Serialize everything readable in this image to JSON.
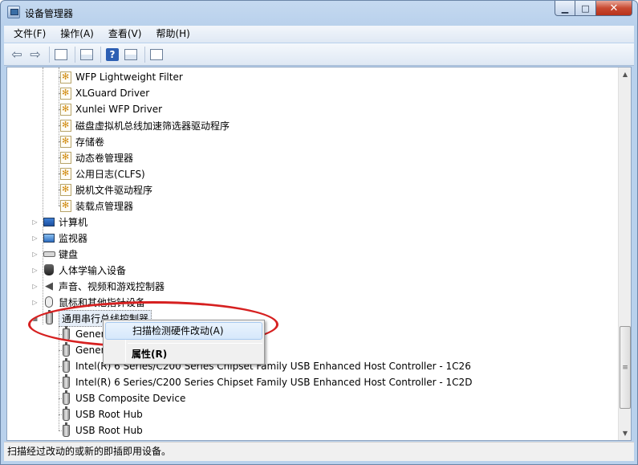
{
  "window": {
    "title": "设备管理器",
    "min_label": "▁",
    "max_label": "□",
    "close_label": "✕"
  },
  "menubar": [
    {
      "label": "文件(F)"
    },
    {
      "label": "操作(A)"
    },
    {
      "label": "查看(V)"
    },
    {
      "label": "帮助(H)"
    }
  ],
  "toolbar": {
    "back_icon": "arrow-left-icon",
    "forward_icon": "arrow-right-icon",
    "help_glyph": "?"
  },
  "tree": {
    "storage_children": [
      {
        "label": "WFP Lightweight Filter",
        "icon": "driver-icon"
      },
      {
        "label": "XLGuard Driver",
        "icon": "driver-icon"
      },
      {
        "label": "Xunlei WFP Driver",
        "icon": "driver-icon"
      },
      {
        "label": "磁盘虚拟机总线加速筛选器驱动程序",
        "icon": "driver-icon"
      },
      {
        "label": "存储卷",
        "icon": "driver-icon"
      },
      {
        "label": "动态卷管理器",
        "icon": "driver-icon"
      },
      {
        "label": "公用日志(CLFS)",
        "icon": "driver-icon"
      },
      {
        "label": "脱机文件驱动程序",
        "icon": "driver-icon"
      },
      {
        "label": "装载点管理器",
        "icon": "driver-icon"
      }
    ],
    "categories": [
      {
        "label": "计算机",
        "icon": "computer-icon"
      },
      {
        "label": "监视器",
        "icon": "monitor-icon"
      },
      {
        "label": "键盘",
        "icon": "keyboard-icon"
      },
      {
        "label": "人体学输入设备",
        "icon": "hid-icon"
      },
      {
        "label": "声音、视频和游戏控制器",
        "icon": "speaker-icon"
      },
      {
        "label": "鼠标和其他指针设备",
        "icon": "mouse-icon"
      }
    ],
    "usb_category": {
      "label": "通用串行总线控制器",
      "icon": "usb-icon"
    },
    "usb_children": [
      {
        "label": "Gener",
        "icon": "usb-icon"
      },
      {
        "label": "Gener",
        "icon": "usb-icon"
      },
      {
        "label": "Intel(R) 6 Series/C200 Series Chipset Family USB Enhanced Host Controller - 1C26",
        "icon": "usb-icon"
      },
      {
        "label": "Intel(R) 6 Series/C200 Series Chipset Family USB Enhanced Host Controller - 1C2D",
        "icon": "usb-icon"
      },
      {
        "label": "USB Composite Device",
        "icon": "usb-icon"
      },
      {
        "label": "USB Root Hub",
        "icon": "usb-icon"
      },
      {
        "label": "USB Root Hub",
        "icon": "usb-icon"
      }
    ],
    "expander_collapsed": "▷",
    "expander_expanded": "◢"
  },
  "context_menu": {
    "scan_label": "扫描检测硬件改动(A)",
    "properties_label": "属性(R)"
  },
  "scrollbar": {
    "up_glyph": "▲",
    "down_glyph": "▼",
    "thumb_grip": "≡"
  },
  "statusbar": {
    "text": "扫描经过改动的或新的即插即用设备。"
  },
  "annotation": {
    "color": "#d62020"
  }
}
